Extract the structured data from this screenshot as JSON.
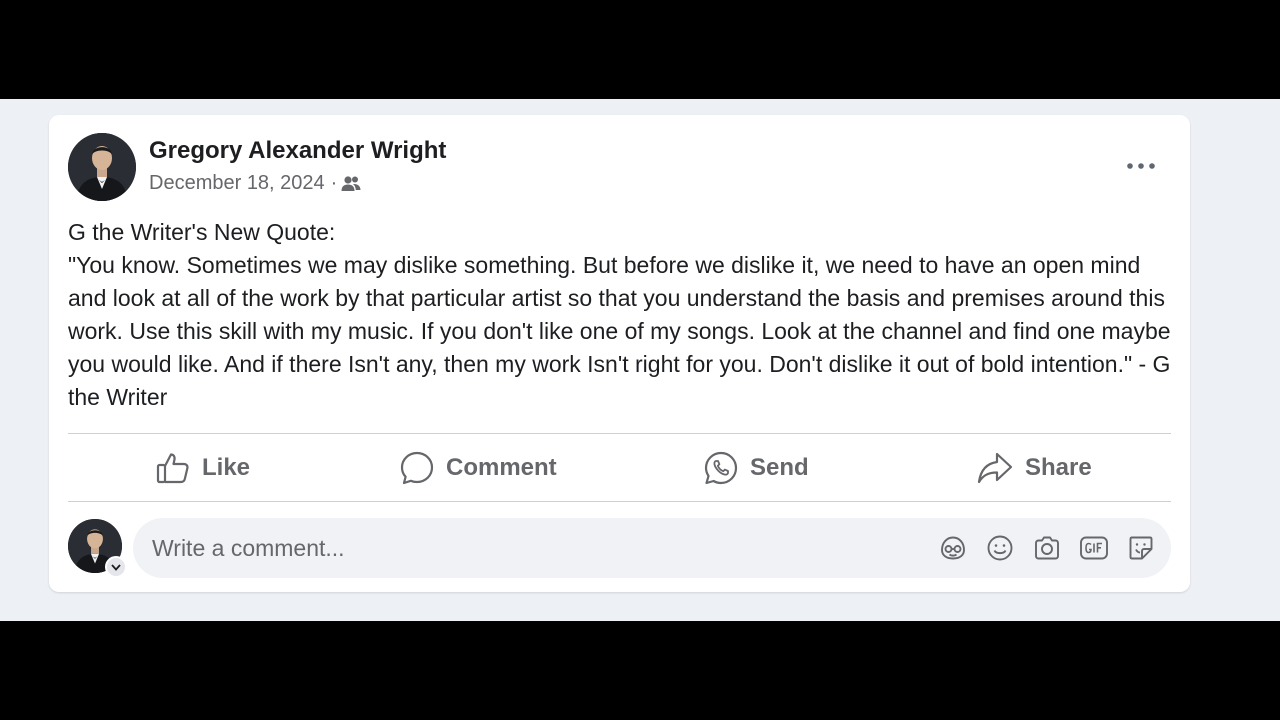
{
  "post": {
    "author_name": "Gregory Alexander Wright",
    "date": "December 18, 2024",
    "meta_separator": "·",
    "audience_icon": "friends-icon",
    "body_title": "G the Writer's New Quote:",
    "body_text": "\"You know. Sometimes we may dislike something. But before we dislike it, we need to have an open mind and look at all of the work by that particular artist so that you understand the basis and premises around this work. Use this skill with my music. If you don't like one of my songs. Look at the channel and find one maybe you would like. And if there Isn't any, then my work Isn't right for you. Don't dislike it out of bold intention.\" - G the Writer"
  },
  "actions": {
    "like_label": "Like",
    "comment_label": "Comment",
    "send_label": "Send",
    "share_label": "Share"
  },
  "comment": {
    "placeholder": "Write a comment...",
    "tools": [
      "avatar-sticker-icon",
      "emoji-icon",
      "camera-icon",
      "gif-icon",
      "sticker-icon"
    ]
  },
  "colors": {
    "page_background": "#edf0f4",
    "card_background": "#ffffff",
    "primary_text": "#1c1e21",
    "secondary_text": "#65676b",
    "input_background": "#f0f2f5"
  }
}
